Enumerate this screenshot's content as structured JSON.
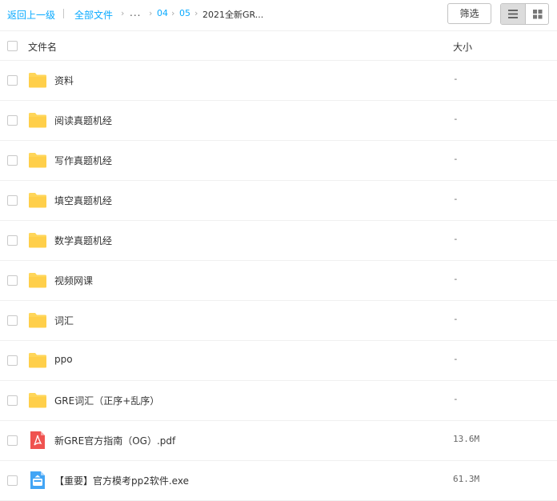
{
  "breadcrumb": {
    "back": "返回上一级",
    "all_files": "全部文件",
    "ellipsis": "...",
    "level_04": "04",
    "level_05": "05",
    "current": "2021全新GR..."
  },
  "toolbar": {
    "filter_label": "筛选",
    "view_mode": "list"
  },
  "table": {
    "columns": {
      "name": "文件名",
      "size": "大小"
    },
    "rows": [
      {
        "name": "资料",
        "size": "-",
        "icon": "folder-icon"
      },
      {
        "name": "阅读真题机经",
        "size": "-",
        "icon": "folder-icon"
      },
      {
        "name": "写作真题机经",
        "size": "-",
        "icon": "folder-icon"
      },
      {
        "name": "填空真题机经",
        "size": "-",
        "icon": "folder-icon"
      },
      {
        "name": "数学真题机经",
        "size": "-",
        "icon": "folder-icon"
      },
      {
        "name": "视频网课",
        "size": "-",
        "icon": "folder-icon"
      },
      {
        "name": "词汇",
        "size": "-",
        "icon": "folder-icon"
      },
      {
        "name": "ppo",
        "size": "-",
        "icon": "folder-icon"
      },
      {
        "name": "GRE词汇（正序+乱序）",
        "size": "-",
        "icon": "folder-icon"
      },
      {
        "name": "新GRE官方指南（OG）.pdf",
        "size": "13.6M",
        "icon": "pdf-icon"
      },
      {
        "name": "【重要】官方模考pp2软件.exe",
        "size": "61.3M",
        "icon": "exe-icon"
      }
    ]
  },
  "colors": {
    "link": "#09aaff",
    "folder": "#ffd659",
    "pdf": "#ef5350",
    "exe": "#42a5f5"
  }
}
